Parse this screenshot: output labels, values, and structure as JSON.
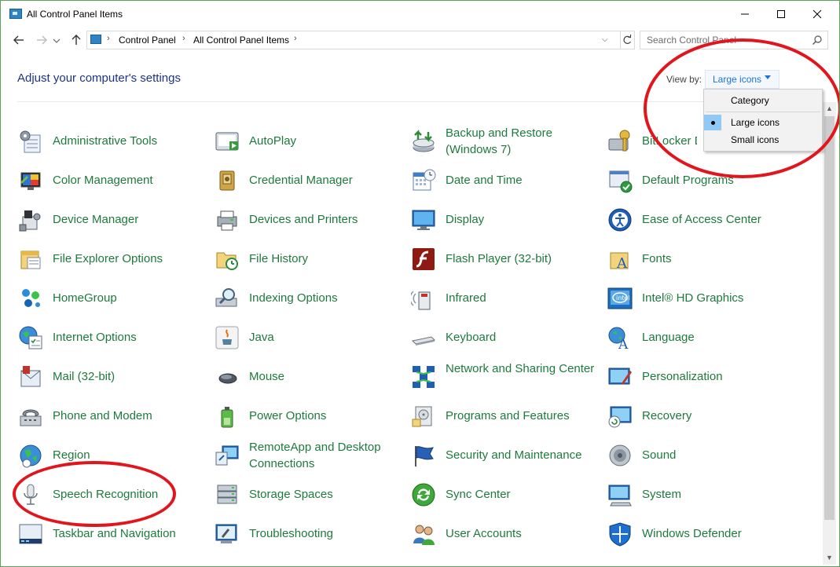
{
  "window": {
    "title": "All Control Panel Items",
    "icon": "control-panel-icon"
  },
  "address": {
    "crumbs": [
      "Control Panel",
      "All Control Panel Items"
    ],
    "search_placeholder": "Search Control Panel"
  },
  "header": {
    "heading": "Adjust your computer's settings",
    "view_by_label": "View by:",
    "view_by_value": "Large icons"
  },
  "view_menu": {
    "options": [
      "Category",
      "Large icons",
      "Small icons"
    ],
    "selected": "Large icons"
  },
  "items": [
    {
      "label": "Administrative Tools",
      "icon": "admin-tools-icon"
    },
    {
      "label": "AutoPlay",
      "icon": "autoplay-icon"
    },
    {
      "label": "Backup and Restore (Windows 7)",
      "icon": "backup-restore-icon"
    },
    {
      "label": "BitLocker Drive Encryption",
      "icon": "bitlocker-icon"
    },
    {
      "label": "Color Management",
      "icon": "color-management-icon"
    },
    {
      "label": "Credential Manager",
      "icon": "credential-manager-icon"
    },
    {
      "label": "Date and Time",
      "icon": "date-time-icon"
    },
    {
      "label": "Default Programs",
      "icon": "default-programs-icon"
    },
    {
      "label": "Device Manager",
      "icon": "device-manager-icon"
    },
    {
      "label": "Devices and Printers",
      "icon": "devices-printers-icon"
    },
    {
      "label": "Display",
      "icon": "display-icon"
    },
    {
      "label": "Ease of Access Center",
      "icon": "ease-of-access-icon"
    },
    {
      "label": "File Explorer Options",
      "icon": "file-explorer-options-icon"
    },
    {
      "label": "File History",
      "icon": "file-history-icon"
    },
    {
      "label": "Flash Player (32-bit)",
      "icon": "flash-player-icon"
    },
    {
      "label": "Fonts",
      "icon": "fonts-icon"
    },
    {
      "label": "HomeGroup",
      "icon": "homegroup-icon"
    },
    {
      "label": "Indexing Options",
      "icon": "indexing-options-icon"
    },
    {
      "label": "Infrared",
      "icon": "infrared-icon"
    },
    {
      "label": "Intel® HD Graphics",
      "icon": "intel-graphics-icon"
    },
    {
      "label": "Internet Options",
      "icon": "internet-options-icon"
    },
    {
      "label": "Java",
      "icon": "java-icon"
    },
    {
      "label": "Keyboard",
      "icon": "keyboard-icon"
    },
    {
      "label": "Language",
      "icon": "language-icon"
    },
    {
      "label": "Mail (32-bit)",
      "icon": "mail-icon"
    },
    {
      "label": "Mouse",
      "icon": "mouse-icon"
    },
    {
      "label": "Network and Sharing Center",
      "icon": "network-sharing-icon"
    },
    {
      "label": "Personalization",
      "icon": "personalization-icon"
    },
    {
      "label": "Phone and Modem",
      "icon": "phone-modem-icon"
    },
    {
      "label": "Power Options",
      "icon": "power-options-icon"
    },
    {
      "label": "Programs and Features",
      "icon": "programs-features-icon"
    },
    {
      "label": "Recovery",
      "icon": "recovery-icon"
    },
    {
      "label": "Region",
      "icon": "region-icon"
    },
    {
      "label": "RemoteApp and Desktop Connections",
      "icon": "remoteapp-icon"
    },
    {
      "label": "Security and Maintenance",
      "icon": "security-maintenance-icon"
    },
    {
      "label": "Sound",
      "icon": "sound-icon"
    },
    {
      "label": "Speech Recognition",
      "icon": "speech-recognition-icon"
    },
    {
      "label": "Storage Spaces",
      "icon": "storage-spaces-icon"
    },
    {
      "label": "Sync Center",
      "icon": "sync-center-icon"
    },
    {
      "label": "System",
      "icon": "system-icon"
    },
    {
      "label": "Taskbar and Navigation",
      "icon": "taskbar-navigation-icon"
    },
    {
      "label": "Troubleshooting",
      "icon": "troubleshooting-icon"
    },
    {
      "label": "User Accounts",
      "icon": "user-accounts-icon"
    },
    {
      "label": "Windows Defender",
      "icon": "windows-defender-icon"
    }
  ],
  "colors": {
    "item_text": "#1e7a3c",
    "heading_text": "#1e3287",
    "link_blue": "#1a73d9",
    "annotation_red": "#e1151b"
  }
}
